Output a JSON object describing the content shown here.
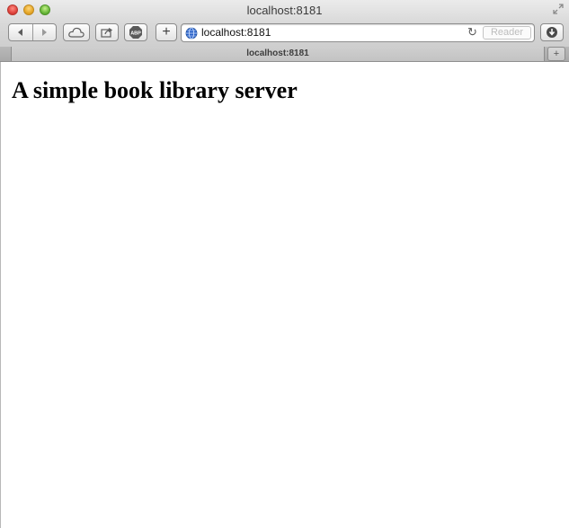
{
  "window": {
    "title": "localhost:8181"
  },
  "toolbar": {
    "address": "localhost:8181",
    "reader_label": "Reader",
    "abp_label": "ABP",
    "add_label": "+"
  },
  "tabs": [
    {
      "title": "localhost:8181"
    }
  ],
  "newtab_label": "+",
  "page": {
    "heading": "A simple book library server"
  },
  "icons": {
    "back": "back-arrow-icon",
    "forward": "forward-arrow-icon",
    "icloud": "cloud-icon",
    "share": "share-icon",
    "adblock": "adblock-icon",
    "globe": "globe-icon",
    "reload": "reload-icon",
    "downloads": "downloads-icon",
    "fullscreen": "fullscreen-icon"
  },
  "colors": {
    "close": "#e0443e",
    "minimize": "#e6a727",
    "maximize": "#69b83a",
    "link": "#2b63c9"
  }
}
